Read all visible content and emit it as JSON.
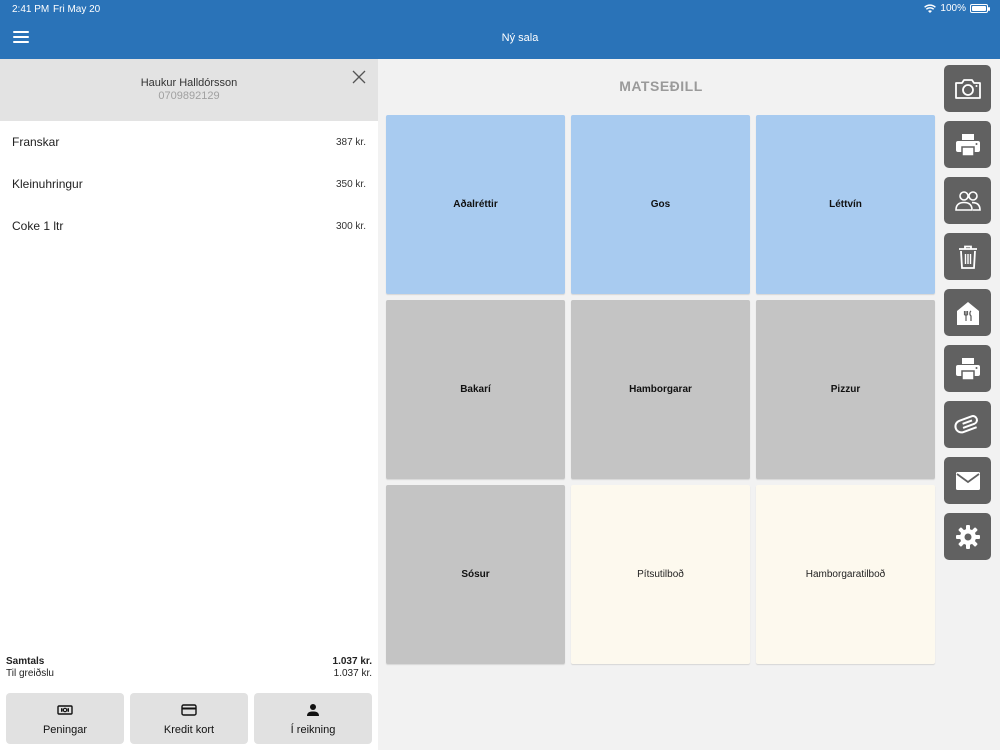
{
  "status_bar": {
    "time": "2:41 PM",
    "date": "Fri May 20",
    "battery": "100%"
  },
  "header": {
    "title": "Ný sala"
  },
  "customer": {
    "name": "Haukur Halldórsson",
    "id": "0709892129"
  },
  "order_items": [
    {
      "name": "Franskar",
      "price": "387 kr."
    },
    {
      "name": "Kleinuhringur",
      "price": "350 kr."
    },
    {
      "name": "Coke 1 ltr",
      "price": "300 kr."
    }
  ],
  "totals": {
    "total_label": "Samtals",
    "total_value": "1.037 kr.",
    "due_label": "Til greiðslu",
    "due_value": "1.037 kr."
  },
  "payment_buttons": [
    {
      "label": "Peningar",
      "icon": "cash-icon"
    },
    {
      "label": "Kredit kort",
      "icon": "credit-card-icon"
    },
    {
      "label": "Í reikning",
      "icon": "person-icon"
    }
  ],
  "menu": {
    "title": "MATSEÐILL",
    "tiles": [
      {
        "label": "Aðalréttir",
        "style": "blue"
      },
      {
        "label": "Gos",
        "style": "blue"
      },
      {
        "label": "Léttvín",
        "style": "blue"
      },
      {
        "label": "Bakarí",
        "style": "gray"
      },
      {
        "label": "Hamborgarar",
        "style": "gray"
      },
      {
        "label": "Pizzur",
        "style": "gray"
      },
      {
        "label": "Sósur",
        "style": "gray"
      },
      {
        "label": "Pítsutilboð",
        "style": "cream"
      },
      {
        "label": "Hamborgaratilboð",
        "style": "cream"
      }
    ]
  },
  "toolbar": {
    "buttons": [
      {
        "icon": "camera-icon"
      },
      {
        "icon": "printer-icon"
      },
      {
        "icon": "people-icon"
      },
      {
        "icon": "trash-icon"
      },
      {
        "icon": "restaurant-house-icon"
      },
      {
        "icon": "printer-icon"
      },
      {
        "icon": "paperclip-icon"
      },
      {
        "icon": "mail-icon"
      },
      {
        "icon": "gear-icon"
      }
    ]
  },
  "colors": {
    "header": "#2a73b8",
    "tile_blue": "#a8cbf0",
    "tile_gray": "#c4c4c4",
    "tile_cream": "#fdf9ee",
    "toolbar_button": "#616161"
  }
}
